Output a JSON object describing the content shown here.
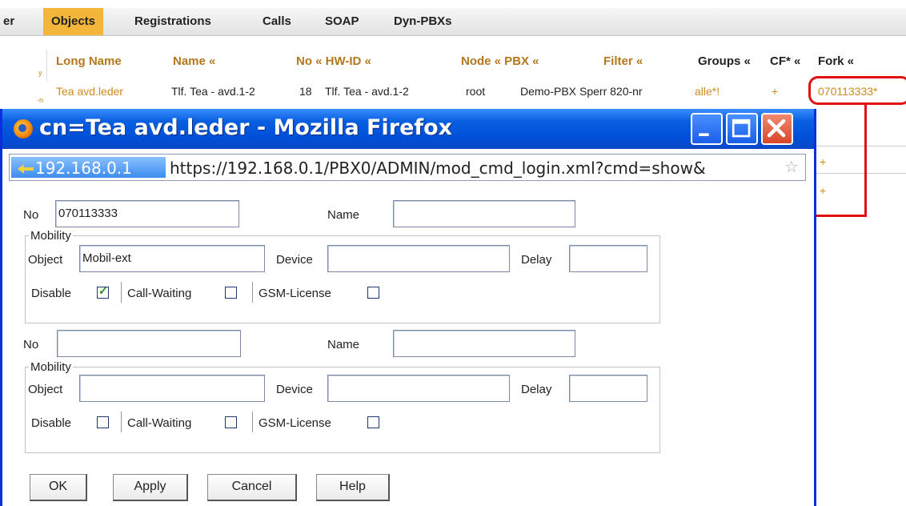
{
  "nav": {
    "items": [
      "er",
      "Objects",
      "Registrations",
      "Calls",
      "SOAP",
      "Dyn-PBXs"
    ],
    "active": "Objects"
  },
  "left_strip": [
    "y",
    "-n"
  ],
  "table": {
    "headers": [
      "Long Name",
      "Name «",
      "No « HW-ID «",
      "Node « PBX «",
      "Filter «",
      "Groups «",
      "CF* «",
      "Fork «"
    ],
    "row": {
      "long_name": "Tea avd.leder",
      "name": "Tlf. Tea - avd.1-2",
      "no": "18",
      "hw_id": "Tlf. Tea - avd.1-2",
      "node": "root",
      "pbx": "Demo-PBX",
      "filter": "Sperr 820-nr",
      "groups": "alle*!",
      "cf": "+",
      "fork": "070113333*"
    },
    "extra_plus": [
      "+",
      "+"
    ]
  },
  "popup": {
    "title": "cn=Tea avd.leder - Mozilla Firefox",
    "site_ip": "192.168.0.1",
    "url": "https://192.168.0.1/PBX0/ADMIN/mod_cmd_login.xml?cmd=show&",
    "entry1": {
      "no_label": "No",
      "no_value": "070113333",
      "name_label": "Name",
      "name_value": "",
      "mobility_legend": "Mobility",
      "object_label": "Object",
      "object_value": "Mobil-ext",
      "device_label": "Device",
      "device_value": "",
      "delay_label": "Delay",
      "delay_value": "",
      "disable_label": "Disable",
      "disable_checked": true,
      "callwaiting_label": "Call-Waiting",
      "callwaiting_checked": false,
      "gsm_label": "GSM-License",
      "gsm_checked": false
    },
    "entry2": {
      "no_label": "No",
      "no_value": "",
      "name_label": "Name",
      "name_value": "",
      "mobility_legend": "Mobility",
      "object_label": "Object",
      "object_value": "",
      "device_label": "Device",
      "device_value": "",
      "delay_label": "Delay",
      "delay_value": "",
      "disable_label": "Disable",
      "disable_checked": false,
      "callwaiting_label": "Call-Waiting",
      "callwaiting_checked": false,
      "gsm_label": "GSM-License",
      "gsm_checked": false
    },
    "buttons": {
      "ok": "OK",
      "apply": "Apply",
      "cancel": "Cancel",
      "help": "Help"
    }
  },
  "colors": {
    "accent": "#f4b63a",
    "annotation": "#e21010",
    "titlebar": "#0a5fe0"
  }
}
